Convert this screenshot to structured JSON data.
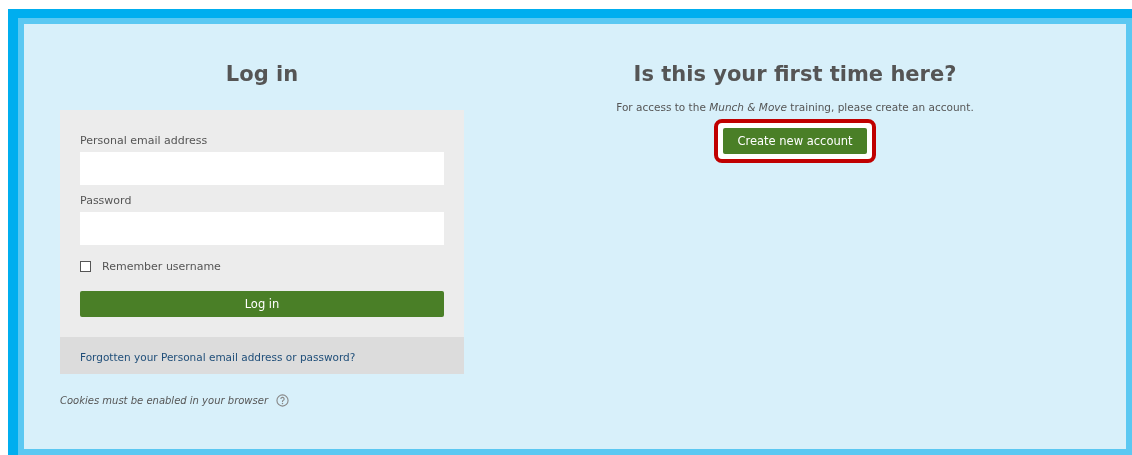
{
  "login": {
    "title": "Log in",
    "fields": [
      {
        "label": "Personal email address"
      },
      {
        "label": "Password"
      }
    ],
    "remember": {
      "label": "Remember username",
      "checked": false
    },
    "button": "Log in",
    "forgot_link": "Forgotten your Personal email address or password?",
    "cookies_note": "Cookies must be enabled in your browser"
  },
  "signup": {
    "title": "Is this your first time here?",
    "text": "For access to the *Munch & Move* training, please create an account.",
    "button": "Create new account",
    "highlighted": true
  }
}
